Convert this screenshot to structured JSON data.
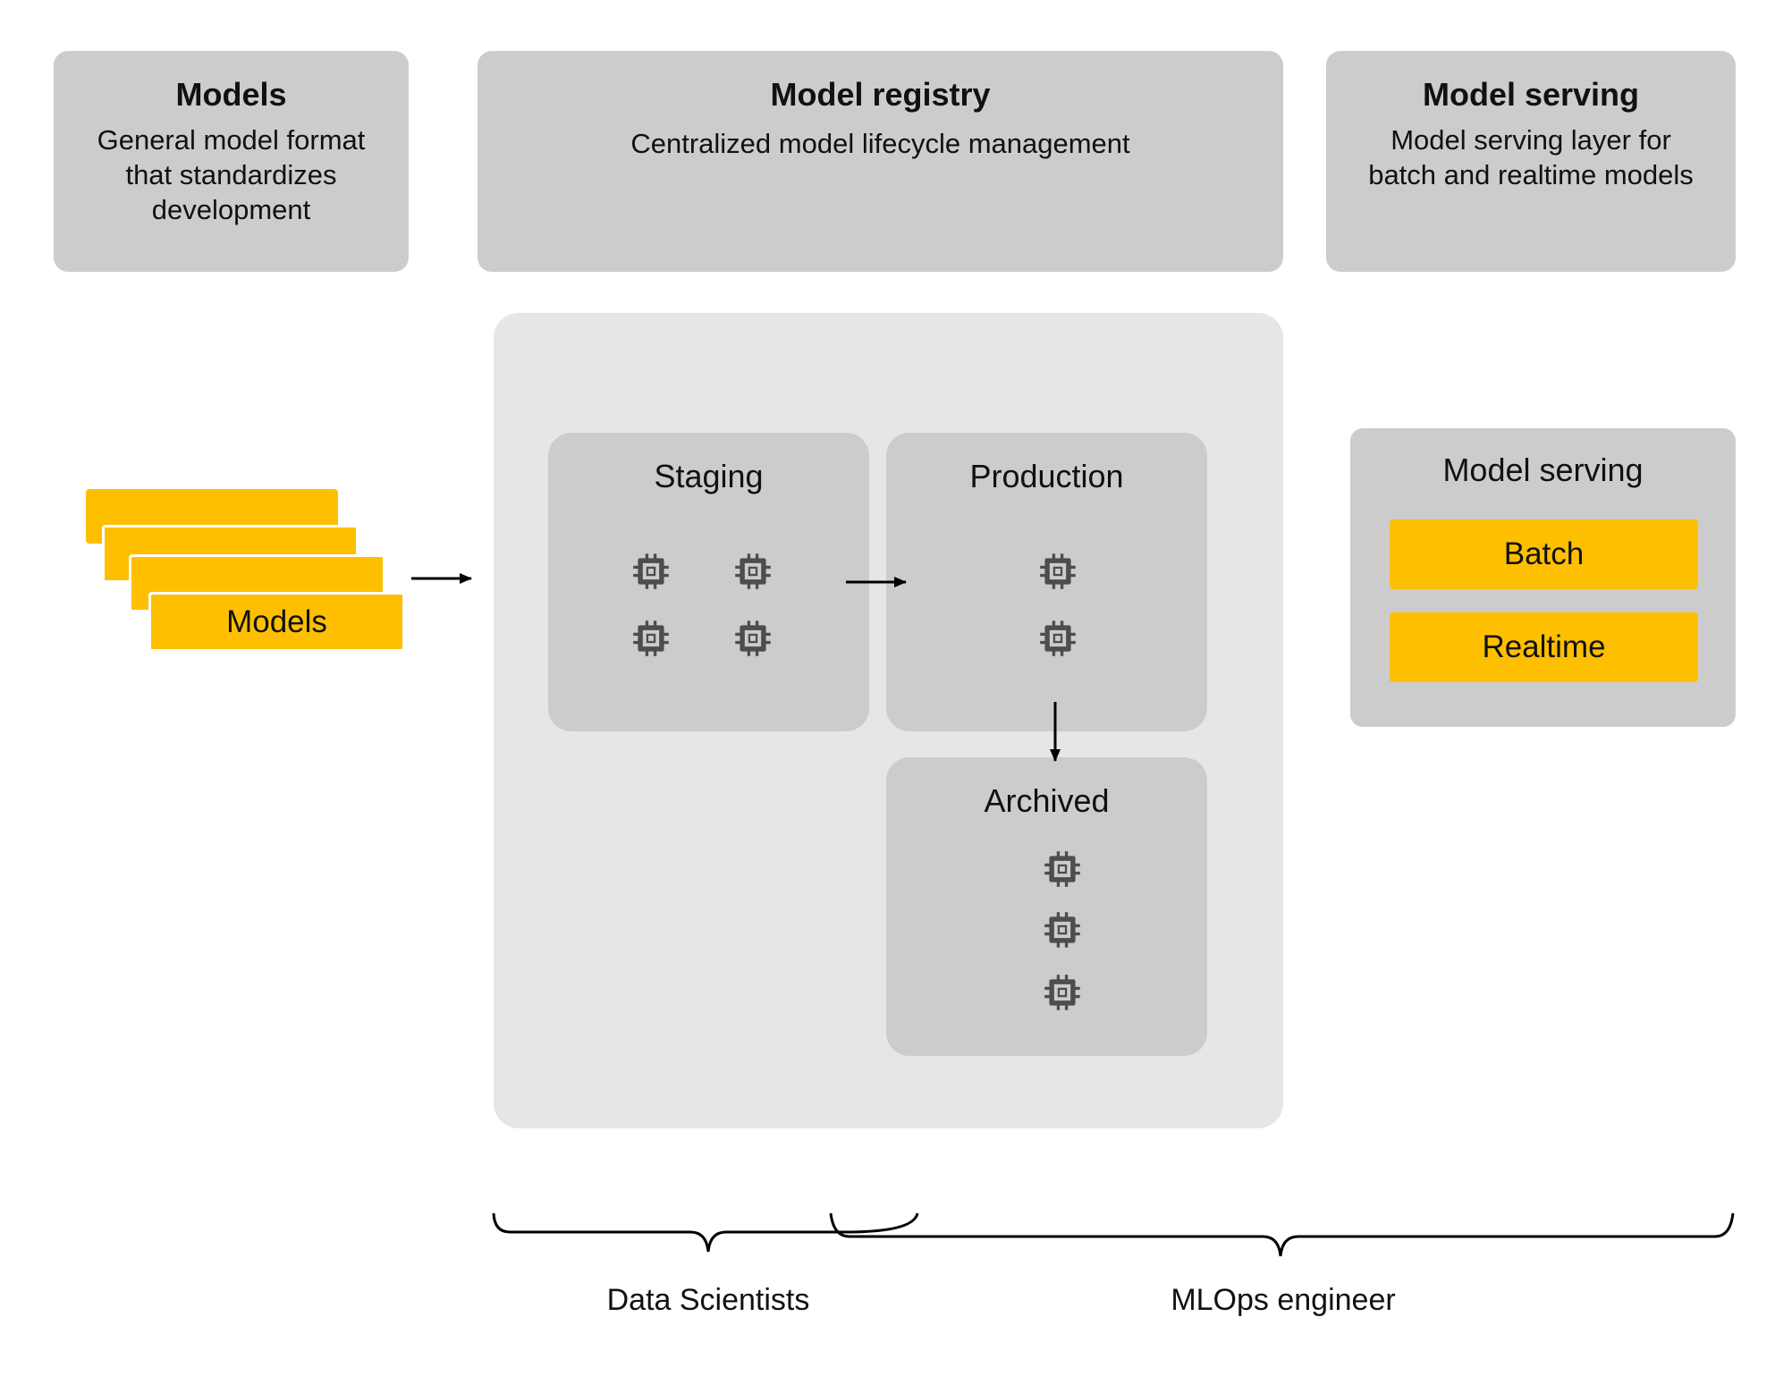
{
  "header": {
    "models": {
      "title": "Models",
      "desc": [
        "General model format",
        "that standardizes",
        "development"
      ]
    },
    "registry": {
      "title": "Model registry",
      "desc": [
        "Centralized model lifecycle management"
      ]
    },
    "serving": {
      "title": "Model serving",
      "desc": [
        "Model serving layer for",
        "batch and realtime models"
      ]
    }
  },
  "models_stack": {
    "label": "Models",
    "count": 4
  },
  "registry": {
    "stages": [
      {
        "name": "Staging",
        "model_count": 4
      },
      {
        "name": "Production",
        "model_count": 2
      },
      {
        "name": "Archived",
        "model_count": 3
      }
    ]
  },
  "serving_panel": {
    "title": "Model serving",
    "modes": [
      "Batch",
      "Realtime"
    ]
  },
  "roles": [
    {
      "label": "Data Scientists"
    },
    {
      "label": "MLOps engineer"
    }
  ],
  "colors": {
    "accent_yellow": "#fdbf00",
    "box_gray": "#cccccc",
    "panel_gray": "#e6e6e6",
    "icon_dark": "#4d4d4d"
  }
}
